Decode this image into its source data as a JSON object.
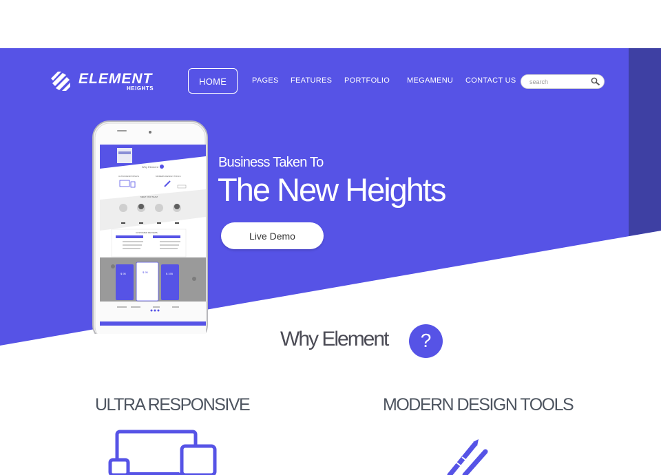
{
  "brand": {
    "name": "ELEMENT",
    "sub": "HEIGHTS"
  },
  "nav": {
    "items": [
      {
        "label": "HOME",
        "active": true
      },
      {
        "label": "PAGES"
      },
      {
        "label": "FEATURES"
      },
      {
        "label": "PORTFOLIO"
      },
      {
        "label": "MEGAMENU"
      },
      {
        "label": "CONTACT US"
      }
    ]
  },
  "search": {
    "placeholder": "search",
    "icon": "search-icon"
  },
  "hero": {
    "tagline": "Business Taken To",
    "headline": "The New Heights",
    "cta_label": "Live Demo"
  },
  "why": {
    "title": "Why Element",
    "badge": "?"
  },
  "features": [
    {
      "title": "ULTRA RESPONSIVE",
      "icon": "devices-icon"
    },
    {
      "title": "MODERN DESIGN TOOLS",
      "icon": "pencil-tools-icon"
    }
  ],
  "colors": {
    "accent": "#5653e6",
    "accent_dark": "#3e40a3",
    "background": "#ffffff"
  }
}
